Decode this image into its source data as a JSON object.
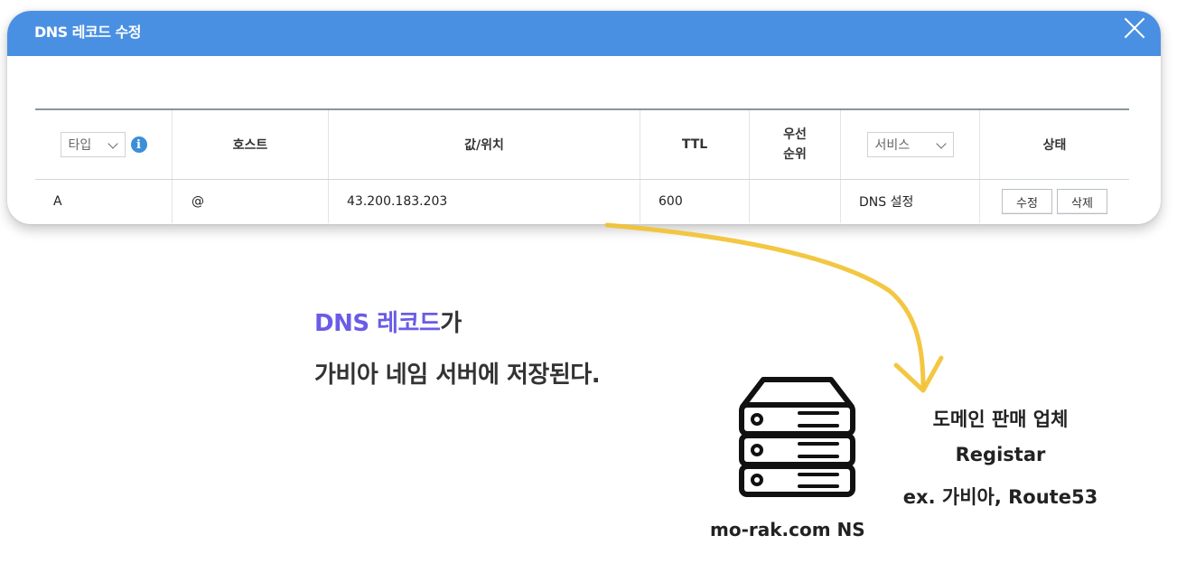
{
  "dialog": {
    "title": "DNS 레코드 수정",
    "close_icon": "close-icon"
  },
  "table": {
    "headers": {
      "type_select": "타입",
      "info_icon_glyph": "i",
      "host": "호스트",
      "value": "값/위치",
      "ttl": "TTL",
      "priority_line1": "우선",
      "priority_line2": "순위",
      "service_select": "서비스",
      "status": "상태"
    },
    "rows": [
      {
        "type": "A",
        "host": "@",
        "value": "43.200.183.203",
        "ttl": "600",
        "priority": "",
        "service": "DNS 설정",
        "edit_label": "수정",
        "delete_label": "삭제"
      }
    ]
  },
  "annotation": {
    "line1_highlight": "DNS 레코드",
    "line1_rest": "가",
    "line2": "가비아 네임 서버에 저장된다.",
    "server_label": "mo-rak.com NS",
    "registrar_line1": "도메인 판매 업체",
    "registrar_line2": "Registar",
    "registrar_line3": "ex. 가비아, Route53",
    "arrow_color": "#f2c12e",
    "highlight_color": "#6a5ce6"
  },
  "colors": {
    "titlebar": "#4a90e2",
    "info_icon": "#3b8fd8"
  }
}
